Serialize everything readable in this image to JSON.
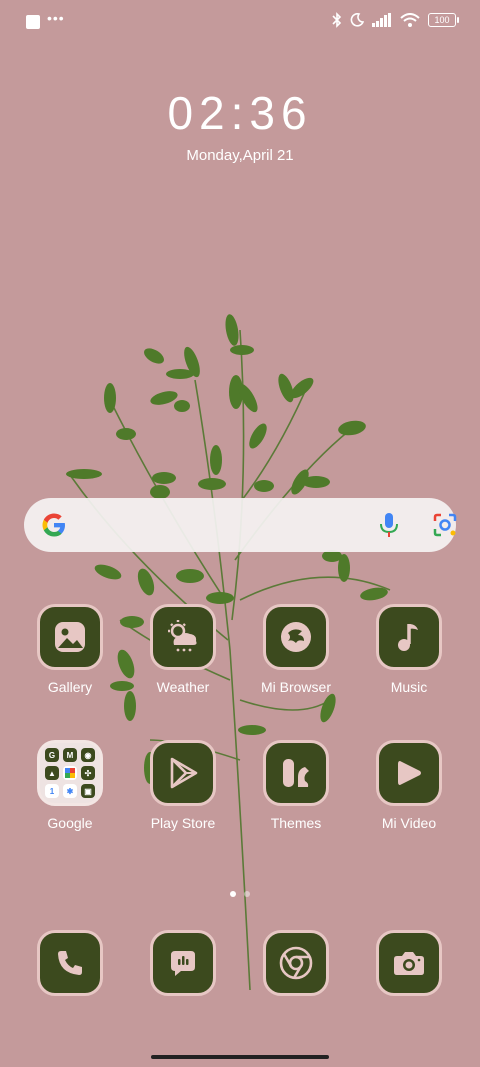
{
  "status_bar": {
    "battery": "100",
    "icons": [
      "app-square-icon",
      "more-dots-icon",
      "bluetooth-icon",
      "moon-icon",
      "signal-icon",
      "wifi-icon",
      "battery-icon"
    ]
  },
  "clock": {
    "time": "02:36",
    "date": "Monday,April 21"
  },
  "search": {
    "icons": [
      "google-g-icon",
      "mic-icon",
      "lens-icon"
    ]
  },
  "apps_row1": [
    {
      "label": "Gallery",
      "icon": "gallery-icon"
    },
    {
      "label": "Weather",
      "icon": "weather-icon"
    },
    {
      "label": "Mi Browser",
      "icon": "browser-icon"
    },
    {
      "label": "Music",
      "icon": "music-note-icon"
    }
  ],
  "apps_row2": [
    {
      "label": "Google",
      "icon": "folder-icon"
    },
    {
      "label": "Play Store",
      "icon": "play-store-icon"
    },
    {
      "label": "Themes",
      "icon": "themes-icon"
    },
    {
      "label": "Mi Video",
      "icon": "video-play-icon"
    }
  ],
  "dock": [
    {
      "icon": "phone-icon"
    },
    {
      "icon": "messages-icon"
    },
    {
      "icon": "chrome-icon"
    },
    {
      "icon": "camera-icon"
    }
  ],
  "colors": {
    "wallpaper": "#c49a9b",
    "icon_bg": "#3c4a1e",
    "icon_fg": "#e7c7c4",
    "leaf": "#4f7a2a"
  }
}
